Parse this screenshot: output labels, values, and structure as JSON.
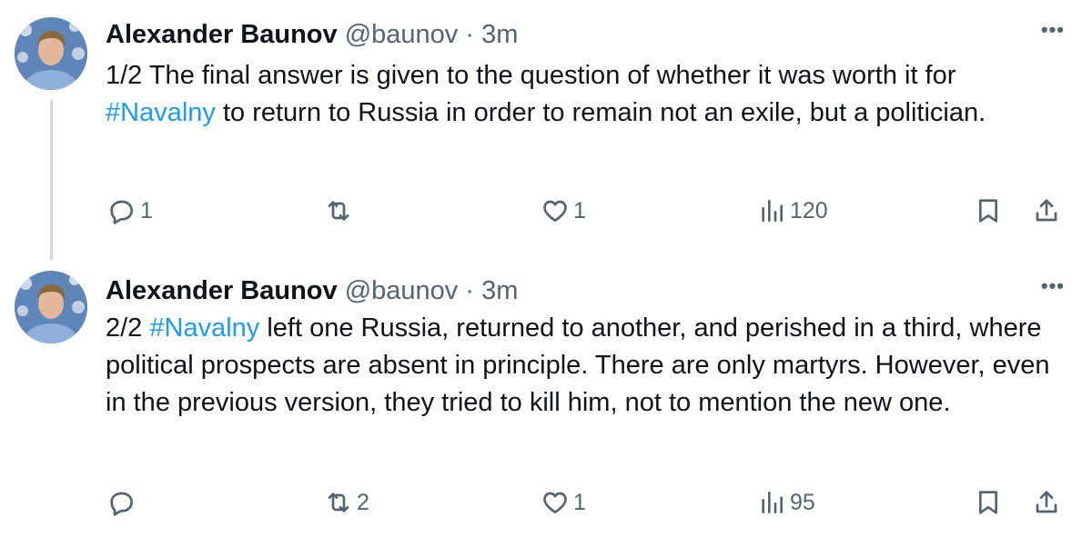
{
  "tweets": [
    {
      "author": "Alexander Baunov",
      "handle": "@baunov",
      "separator": " · ",
      "time": "3m",
      "more": "•••",
      "text_pre": "1/2 The final answer is given to the question of whether it was worth it for ",
      "hashtag": "#Navalny",
      "text_post": " to return to Russia in order to remain not an exile, but a politician.",
      "replies": "1",
      "reposts": "",
      "likes": "1",
      "views": "120"
    },
    {
      "author": "Alexander Baunov",
      "handle": "@baunov",
      "separator": " · ",
      "time": "3m",
      "more": "•••",
      "text_pre": "2/2 ",
      "hashtag": "#Navalny",
      "text_post": " left one Russia, returned to another, and perished in a third, where political prospects are absent in principle. There are only martyrs. However, even in the previous version, they tried to kill him, not to mention the new one.",
      "replies": "",
      "reposts": "2",
      "likes": "1",
      "views": "95"
    }
  ],
  "icons": {
    "reply": "reply-icon",
    "repost": "repost-icon",
    "like": "like-icon",
    "views": "views-icon",
    "bookmark": "bookmark-icon",
    "share": "share-icon"
  },
  "colors": {
    "accent": "#1d9bf0",
    "secondary_text": "#536471",
    "text": "#0f1419",
    "thread_line": "#cfd9de"
  }
}
